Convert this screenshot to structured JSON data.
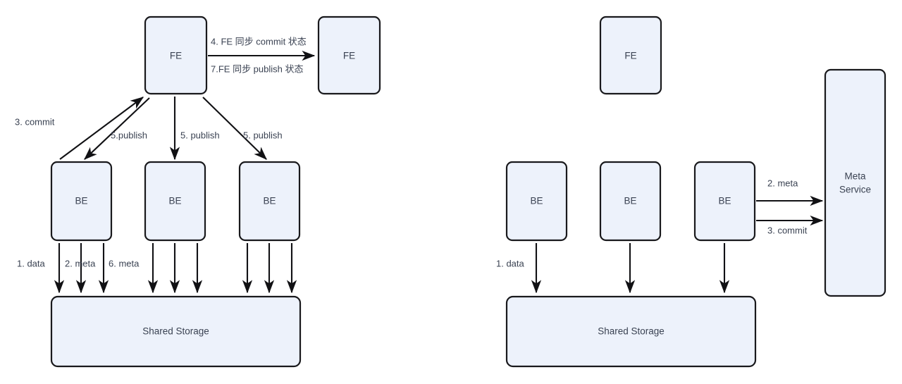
{
  "diagram": {
    "type": "architecture-flow",
    "left_panel": {
      "nodes": {
        "fe_primary": "FE",
        "fe_secondary": "FE",
        "be_1": "BE",
        "be_2": "BE",
        "be_3": "BE",
        "shared_storage": "Shared Storage"
      },
      "edge_labels": {
        "fe_sync_commit": "4. FE 同步 commit 状态",
        "fe_sync_publish": "7.FE 同步 publish 状态",
        "commit": "3. commit",
        "publish_be1": "5.publish",
        "publish_be2": "5. publish",
        "publish_be3": "5. publish",
        "storage_data": "1. data",
        "storage_meta": "2. meta",
        "storage_meta_6": "6. meta"
      }
    },
    "right_panel": {
      "nodes": {
        "fe": "FE",
        "be_1": "BE",
        "be_2": "BE",
        "be_3": "BE",
        "meta_service_line1": "Meta",
        "meta_service_line2": "Service",
        "shared_storage": "Shared Storage"
      },
      "edge_labels": {
        "meta": "2. meta",
        "commit": "3. commit",
        "storage_data": "1. data"
      }
    },
    "colors": {
      "node_fill": "#edf2fb",
      "node_stroke": "#19191c",
      "edge_stroke": "#111114",
      "text": "#3a4252",
      "background": "#ffffff"
    }
  }
}
